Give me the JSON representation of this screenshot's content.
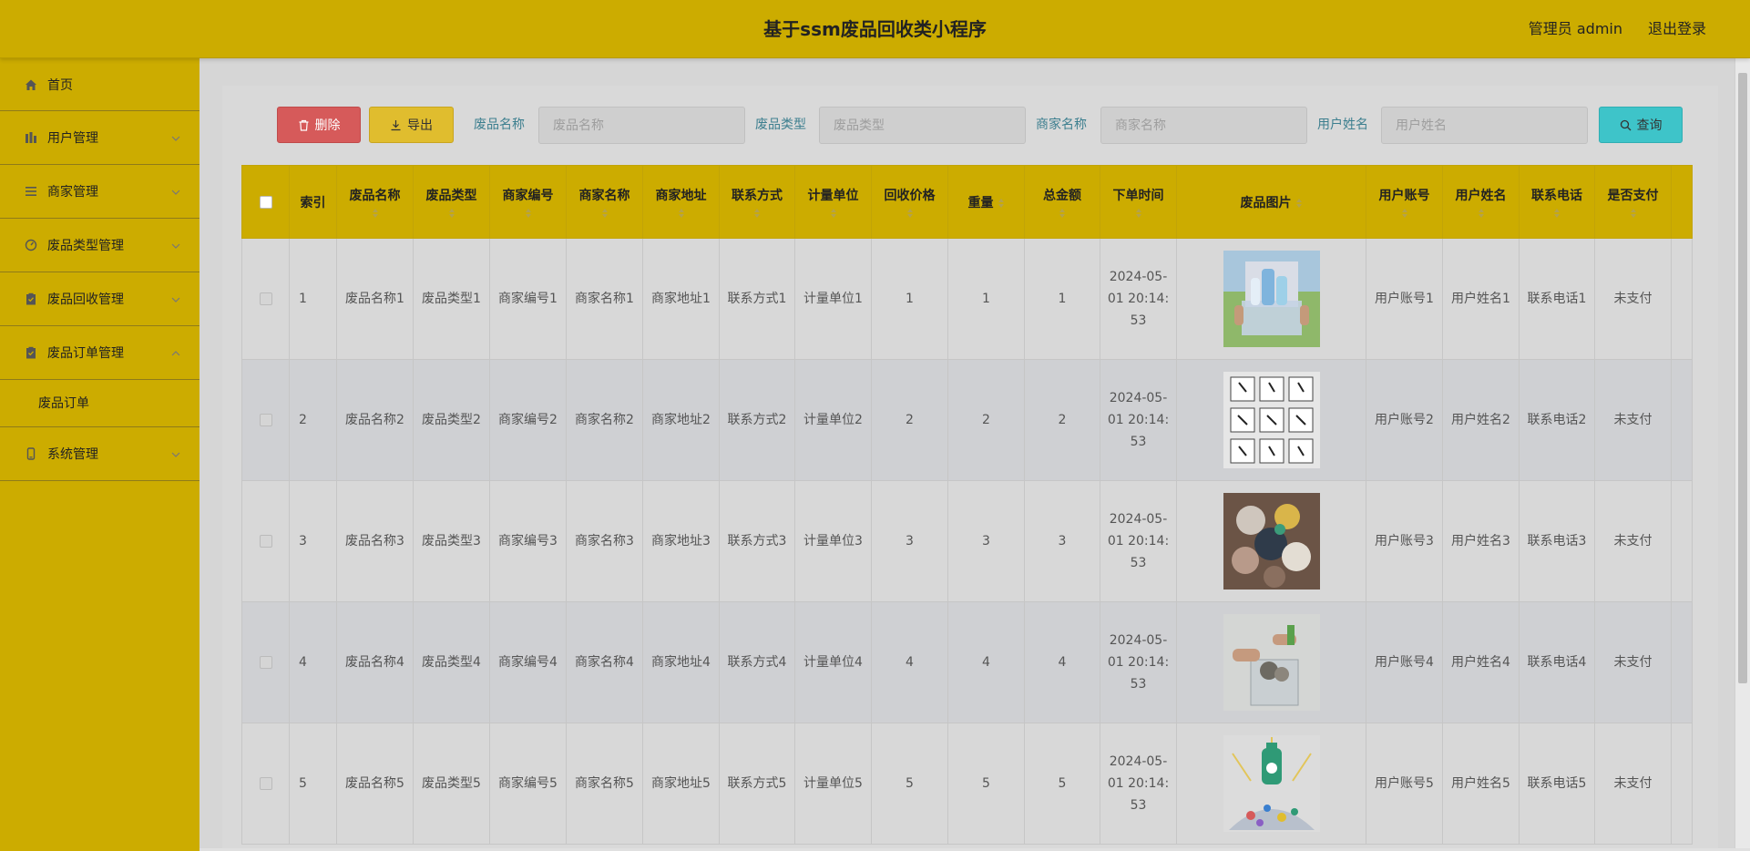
{
  "header": {
    "title": "基于ssm废品回收类小程序",
    "admin_label": "管理员 admin",
    "logout_label": "退出登录"
  },
  "sidebar": {
    "items": [
      {
        "label": "首页",
        "icon": "home-icon"
      },
      {
        "label": "用户管理",
        "icon": "users-icon"
      },
      {
        "label": "商家管理",
        "icon": "list-icon"
      },
      {
        "label": "废品类型管理",
        "icon": "gauge-icon"
      },
      {
        "label": "废品回收管理",
        "icon": "clipboard-icon"
      },
      {
        "label": "废品订单管理",
        "icon": "clipboard-icon",
        "expanded": true
      },
      {
        "label": "系统管理",
        "icon": "phone-icon"
      }
    ],
    "sub_items": [
      {
        "label": "废品订单"
      }
    ]
  },
  "toolbar": {
    "delete_label": "删除",
    "export_label": "导出",
    "query_label": "查询",
    "filters": [
      {
        "label": "废品名称",
        "placeholder": "废品名称"
      },
      {
        "label": "废品类型",
        "placeholder": "废品类型"
      },
      {
        "label": "商家名称",
        "placeholder": "商家名称"
      },
      {
        "label": "用户姓名",
        "placeholder": "用户姓名"
      }
    ]
  },
  "table": {
    "columns": [
      "索引",
      "废品名称",
      "废品类型",
      "商家编号",
      "商家名称",
      "商家地址",
      "联系方式",
      "计量单位",
      "回收价格",
      "重量",
      "总金额",
      "下单时间",
      "废品图片",
      "用户账号",
      "用户姓名",
      "联系电话",
      "是否支付"
    ],
    "rows": [
      {
        "index": "1",
        "name": "废品名称1",
        "type": "废品类型1",
        "shop_no": "商家编号1",
        "shop_name": "商家名称1",
        "shop_addr": "商家地址1",
        "contact": "联系方式1",
        "unit": "计量单位1",
        "price": "1",
        "weight": "1",
        "total": "1",
        "time": "2024-05-01 20:14:53",
        "image": "bottles-in-crate",
        "account": "用户账号1",
        "uname": "用户姓名1",
        "phone": "联系电话1",
        "paid": "未支付"
      },
      {
        "index": "2",
        "name": "废品名称2",
        "type": "废品类型2",
        "shop_no": "商家编号2",
        "shop_name": "商家名称2",
        "shop_addr": "商家地址2",
        "contact": "联系方式2",
        "unit": "计量单位2",
        "price": "2",
        "weight": "2",
        "total": "2",
        "time": "2024-05-01 20:14:53",
        "image": "recycle-icons-grid",
        "account": "用户账号2",
        "uname": "用户姓名2",
        "phone": "联系电话2",
        "paid": "未支付"
      },
      {
        "index": "3",
        "name": "废品名称3",
        "type": "废品类型3",
        "shop_no": "商家编号3",
        "shop_name": "商家名称3",
        "shop_addr": "商家地址3",
        "contact": "联系方式3",
        "unit": "计量单位3",
        "price": "3",
        "weight": "3",
        "total": "3",
        "time": "2024-05-01 20:14:53",
        "image": "clothes-pile",
        "account": "用户账号3",
        "uname": "用户姓名3",
        "phone": "联系电话3",
        "paid": "未支付"
      },
      {
        "index": "4",
        "name": "废品名称4",
        "type": "废品类型4",
        "shop_no": "商家编号4",
        "shop_name": "商家名称4",
        "shop_addr": "商家地址4",
        "contact": "联系方式4",
        "unit": "计量单位4",
        "price": "4",
        "weight": "4",
        "total": "4",
        "time": "2024-05-01 20:14:53",
        "image": "hands-sorting-bin",
        "account": "用户账号4",
        "uname": "用户姓名4",
        "phone": "联系电话4",
        "paid": "未支付"
      },
      {
        "index": "5",
        "name": "废品名称5",
        "type": "废品类型5",
        "shop_no": "商家编号5",
        "shop_name": "商家名称5",
        "shop_addr": "商家地址5",
        "contact": "联系方式5",
        "unit": "计量单位5",
        "price": "5",
        "weight": "5",
        "total": "5",
        "time": "2024-05-01 20:14:53",
        "image": "recycling-illustration",
        "account": "用户账号5",
        "uname": "用户姓名5",
        "phone": "联系电话5",
        "paid": "未支付"
      }
    ]
  }
}
